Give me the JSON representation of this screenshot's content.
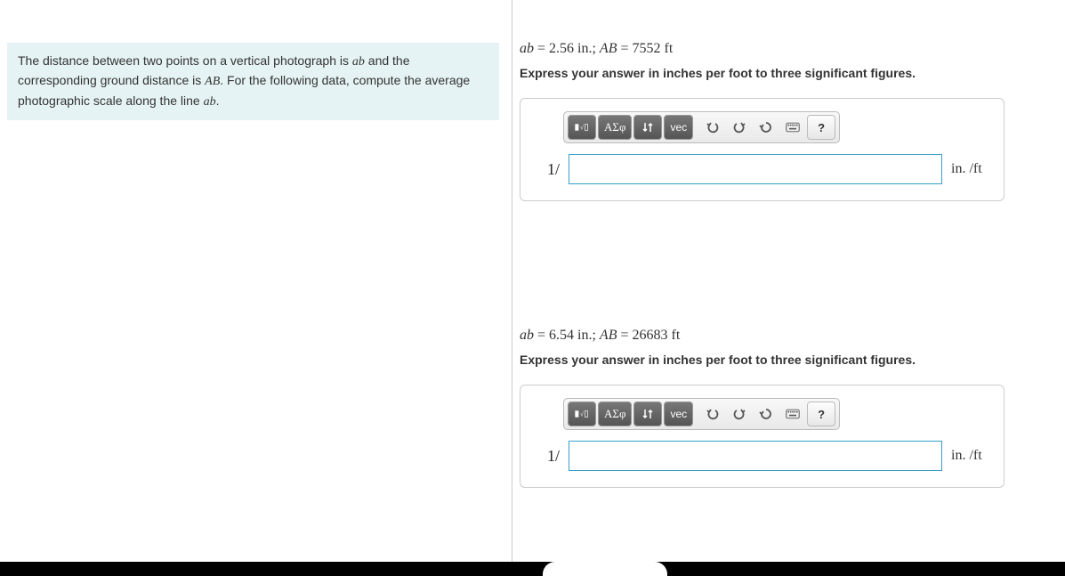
{
  "problem": {
    "text_1": "The distance between two points on a vertical photograph is ",
    "var_ab": "ab",
    "text_2": " and the corresponding ground distance is ",
    "var_AB": "AB",
    "text_3": ". For the following data, compute the average photographic scale along the line ",
    "var_ab2": "ab",
    "text_4": "."
  },
  "parts": [
    {
      "given_prefix": "ab",
      "given_eq1": " = 2.56 in.; ",
      "given_var2": "AB",
      "given_eq2": " = 7552 ft",
      "instruction": "Express your answer in inches per foot to three significant figures.",
      "prefix": "1/",
      "unit": "in. /ft"
    },
    {
      "given_prefix": "ab",
      "given_eq1": " = 6.54 in.; ",
      "given_var2": "AB",
      "given_eq2": " = 26683 ft",
      "instruction": "Express your answer in inches per foot to three significant figures.",
      "prefix": "1/",
      "unit": "in. /ft"
    }
  ],
  "toolbar": {
    "templates": "▯√▯",
    "greek": "ΑΣφ",
    "subscript": "↓↑",
    "vec": "vec",
    "undo": "↶",
    "redo": "↷",
    "reset": "↺",
    "keyboard": "⌨",
    "help": "?"
  }
}
